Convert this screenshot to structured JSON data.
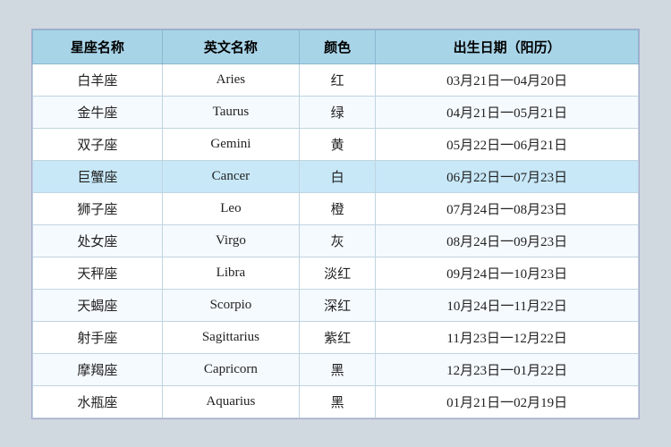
{
  "table": {
    "headers": [
      "星座名称",
      "英文名称",
      "颜色",
      "出生日期（阳历）"
    ],
    "rows": [
      {
        "chinese": "白羊座",
        "english": "Aries",
        "color": "红",
        "dates": "03月21日一04月20日",
        "highlight": false
      },
      {
        "chinese": "金牛座",
        "english": "Taurus",
        "color": "绿",
        "dates": "04月21日一05月21日",
        "highlight": false
      },
      {
        "chinese": "双子座",
        "english": "Gemini",
        "color": "黄",
        "dates": "05月22日一06月21日",
        "highlight": false
      },
      {
        "chinese": "巨蟹座",
        "english": "Cancer",
        "color": "白",
        "dates": "06月22日一07月23日",
        "highlight": true
      },
      {
        "chinese": "狮子座",
        "english": "Leo",
        "color": "橙",
        "dates": "07月24日一08月23日",
        "highlight": false
      },
      {
        "chinese": "处女座",
        "english": "Virgo",
        "color": "灰",
        "dates": "08月24日一09月23日",
        "highlight": false
      },
      {
        "chinese": "天秤座",
        "english": "Libra",
        "color": "淡红",
        "dates": "09月24日一10月23日",
        "highlight": false
      },
      {
        "chinese": "天蝎座",
        "english": "Scorpio",
        "color": "深红",
        "dates": "10月24日一11月22日",
        "highlight": false
      },
      {
        "chinese": "射手座",
        "english": "Sagittarius",
        "color": "紫红",
        "dates": "11月23日一12月22日",
        "highlight": false
      },
      {
        "chinese": "摩羯座",
        "english": "Capricorn",
        "color": "黑",
        "dates": "12月23日一01月22日",
        "highlight": false
      },
      {
        "chinese": "水瓶座",
        "english": "Aquarius",
        "color": "黑",
        "dates": "01月21日一02月19日",
        "highlight": false
      }
    ]
  }
}
